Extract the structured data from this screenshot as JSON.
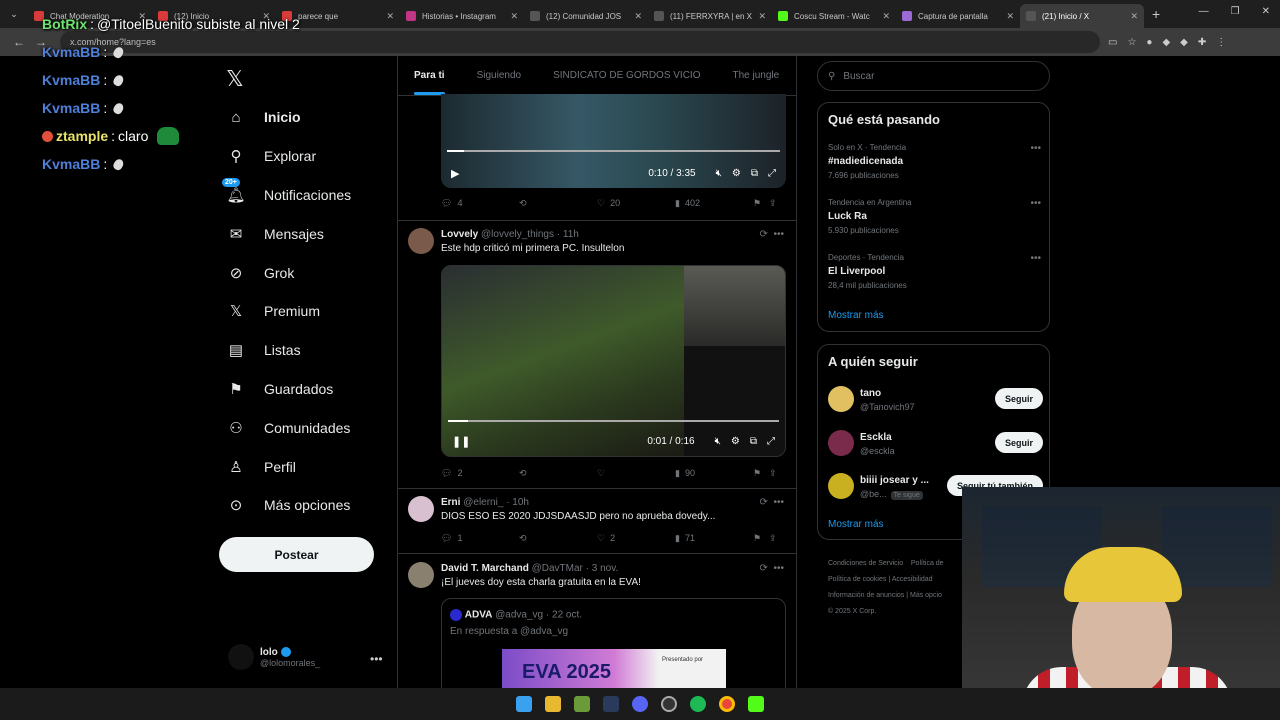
{
  "browser": {
    "tabs": [
      {
        "title": "Chat Moderation",
        "color": "#d83b3b"
      },
      {
        "title": "(12) Inicio",
        "color": "#d83b3b"
      },
      {
        "title": "parece que",
        "color": "#d83b3b"
      },
      {
        "title": "Historias • Instagram",
        "color": "#c13584"
      },
      {
        "title": "(12) Comunidad JOS",
        "color": "#e7e9ea"
      },
      {
        "title": "(11) FERRXYRA | en X",
        "color": "#e7e9ea"
      },
      {
        "title": "Coscu Stream - Watc",
        "color": "#53fc18"
      },
      {
        "title": "Captura de pantalla",
        "color": "#9a6bd6"
      },
      {
        "title": "(21) Inicio / X",
        "color": "#e7e9ea"
      }
    ],
    "url": "x.com/home?lang=es",
    "close_glyph": "✕",
    "add_tab_glyph": "+"
  },
  "chat": {
    "lines": [
      {
        "user": "BotRix",
        "sep": ":",
        "message": "@TitoelBuenito subiste al nivel 2"
      },
      {
        "user": "KvmaBB",
        "sep": ":"
      },
      {
        "user": "KvmaBB",
        "sep": ":"
      },
      {
        "user": "KvmaBB",
        "sep": ":"
      },
      {
        "user": "ztample",
        "sep": ":",
        "message": "claro"
      },
      {
        "user": "KvmaBB",
        "sep": ":"
      }
    ]
  },
  "nav": {
    "logo": "𝕏",
    "notif_badge": "20+",
    "items": [
      {
        "label": "Inicio",
        "icon": "home-icon"
      },
      {
        "label": "Explorar",
        "icon": "search-icon"
      },
      {
        "label": "Notificaciones",
        "icon": "bell-icon"
      },
      {
        "label": "Mensajes",
        "icon": "mail-icon"
      },
      {
        "label": "Grok",
        "icon": "grok-icon"
      },
      {
        "label": "Premium",
        "icon": "x-icon"
      },
      {
        "label": "Listas",
        "icon": "list-icon"
      },
      {
        "label": "Guardados",
        "icon": "bookmark-icon"
      },
      {
        "label": "Comunidades",
        "icon": "people-icon"
      },
      {
        "label": "Perfil",
        "icon": "person-icon"
      },
      {
        "label": "Más opciones",
        "icon": "more-icon"
      }
    ],
    "post_button": "Postear",
    "me": {
      "name": "lolo",
      "handle": "@lolomorales_"
    }
  },
  "timeline": {
    "tabs": [
      "Para ti",
      "Siguiendo",
      "SINDICATO DE GORDOS VICIO",
      "The jungle"
    ],
    "video1": {
      "time": "0:10 / 3:35",
      "progress": 0.05
    },
    "t1_actions": {
      "replies": "4",
      "retweets": "",
      "likes": "20",
      "views": "402"
    },
    "tweets": [
      {
        "name": "Lovvely",
        "handle": "@lovvely_things",
        "time": "· 11h",
        "text": "Este hdp criticó mi primera PC. Insultelon",
        "video_time": "0:01 / 0:16",
        "video_progress": 0.06,
        "replies": "2",
        "retweets": "",
        "likes": "",
        "views": "90"
      },
      {
        "name": "Erni",
        "handle": "@elerni_",
        "time": "· 10h",
        "text": "DIOS ESO ES 2020 JDJSDAASJD pero no aprueba dovedy...",
        "replies": "1",
        "retweets": "",
        "likes": "2",
        "views": "71"
      },
      {
        "name": "David T. Marchand",
        "handle": "@DavTMar",
        "time": "· 3 nov.",
        "text": "¡El jueves doy esta charla gratuita en la EVA!",
        "quote": {
          "name": "ADVA",
          "handle": "@adva_vg",
          "time": "· 22 oct.",
          "reply_to": "En respuesta a @adva_vg",
          "banner_title": "EVA 2025",
          "banner_sub": "Presentado por"
        }
      }
    ]
  },
  "sidebar": {
    "search_placeholder": "Buscar",
    "trends_title": "Qué está pasando",
    "trends": [
      {
        "category": "Solo en X · Tendencia",
        "name": "#nadiedicenada",
        "count": "7.696 publicaciones"
      },
      {
        "category": "Tendencia en Argentina",
        "name": "Luck Ra",
        "count": "5.930 publicaciones"
      },
      {
        "category": "Deportes · Tendencia",
        "name": "El Liverpool",
        "count": "28,4 mil publicaciones"
      }
    ],
    "show_more": "Mostrar más",
    "follow_title": "A quién seguir",
    "follow": [
      {
        "name": "tano",
        "handle": "@Tanovich97",
        "button": "Seguir",
        "avatar_color": "#e0c060"
      },
      {
        "name": "Esckla",
        "handle": "@esckla",
        "button": "Seguir",
        "avatar_color": "#7a2a4a"
      },
      {
        "name": "biiii josear y ...",
        "handle": "@be...",
        "button": "Seguir tú también",
        "tag": "Te sigue",
        "avatar_color": "#c8b020"
      }
    ],
    "footer": [
      "Condiciones de Servicio",
      "Política de",
      "Política de cookies",
      "Accesibilidad",
      "Información de anuncios",
      "Más opcio",
      "© 2025 X Corp."
    ]
  },
  "taskbar": [
    "windows",
    "explorer",
    "minecraft",
    "steam",
    "discord",
    "obs",
    "spotify",
    "chrome",
    "kick"
  ]
}
